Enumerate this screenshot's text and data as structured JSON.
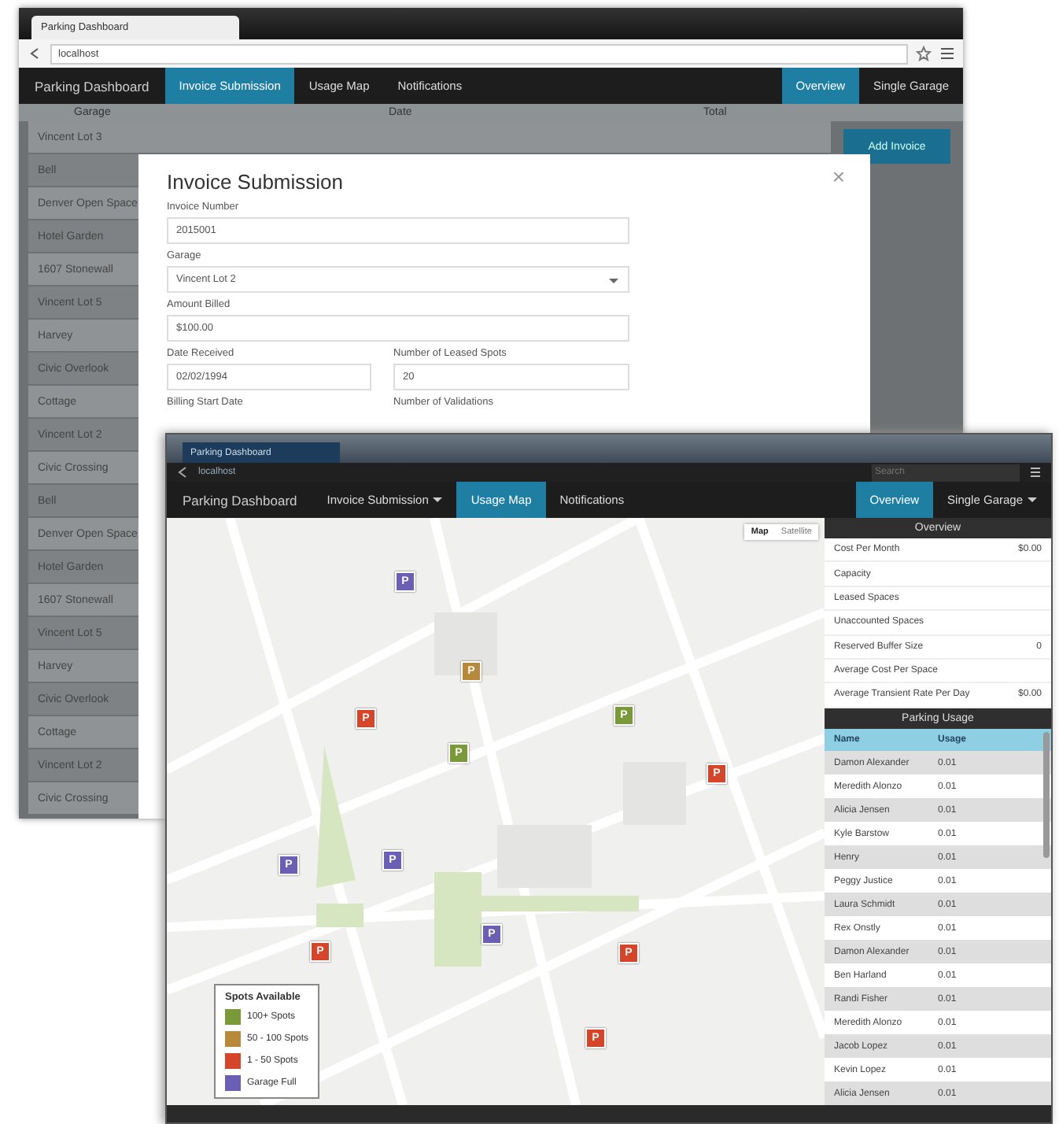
{
  "back_window": {
    "browser_tab": "Parking Dashboard",
    "address": "localhost",
    "brand": "Parking Dashboard",
    "nav": [
      {
        "label": "Invoice Submission",
        "selected": true
      },
      {
        "label": "Usage Map",
        "selected": false
      },
      {
        "label": "Notifications",
        "selected": false
      }
    ],
    "nav_right": [
      {
        "label": "Overview",
        "selected": true
      },
      {
        "label": "Single Garage",
        "selected": false
      }
    ],
    "table": {
      "columns": [
        "Garage",
        "Date",
        "Total"
      ],
      "rows": [
        "Vincent Lot 3",
        "Bell",
        "Denver Open Space",
        "Hotel Garden",
        "1607 Stonewall",
        "Vincent Lot 5",
        "Harvey",
        "Civic Overlook",
        "Cottage",
        "Vincent Lot 2",
        "Civic Crossing",
        "Bell",
        "Denver Open Space",
        "Hotel Garden",
        "1607 Stonewall",
        "Vincent Lot 5",
        "Harvey",
        "Civic Overlook",
        "Cottage",
        "Vincent Lot 2",
        "Civic Crossing"
      ]
    },
    "add_button": "Add Invoice",
    "modal": {
      "title": "Invoice Submission",
      "close": "×",
      "fields": [
        {
          "label": "Invoice Number",
          "value": "2015001",
          "kind": "text"
        },
        {
          "label": "Garage",
          "value": "Vincent Lot 2",
          "kind": "select"
        },
        {
          "label": "Amount Billed",
          "value": "$100.00",
          "kind": "text"
        },
        {
          "label": "Date Received",
          "value": "02/02/1994",
          "kind": "text"
        },
        {
          "label": "Number of Leased Spots",
          "value": "20",
          "kind": "text"
        },
        {
          "label": "Billing Start Date"
        },
        {
          "label": "Number of Validations"
        }
      ]
    }
  },
  "front_window": {
    "browser_tab": "Parking Dashboard",
    "address": "localhost",
    "search_placeholder": "Search",
    "brand": "Parking Dashboard",
    "nav": [
      {
        "label": "Invoice Submission",
        "selected": false,
        "dropdown": true
      },
      {
        "label": "Usage Map",
        "selected": true,
        "dropdown": false
      },
      {
        "label": "Notifications",
        "selected": false,
        "dropdown": false
      }
    ],
    "nav_right": [
      {
        "label": "Overview",
        "selected": true,
        "dropdown": false
      },
      {
        "label": "Single Garage",
        "selected": false,
        "dropdown": true
      }
    ],
    "map_type": [
      {
        "label": "Map",
        "selected": true
      },
      {
        "label": "Satellite",
        "selected": false
      }
    ],
    "markers": [
      {
        "glyph": "P",
        "color": "#6a5fb5"
      },
      {
        "glyph": "P",
        "color": "#b8893a"
      },
      {
        "glyph": "P",
        "color": "#d6452a"
      },
      {
        "glyph": "P",
        "color": "#7a9a3a"
      },
      {
        "glyph": "P",
        "color": "#7a9a3a"
      },
      {
        "glyph": "P",
        "color": "#d6452a"
      },
      {
        "glyph": "P",
        "color": "#6a5fb5"
      },
      {
        "glyph": "P",
        "color": "#6a5fb5"
      },
      {
        "glyph": "P",
        "color": "#6a5fb5"
      },
      {
        "glyph": "P",
        "color": "#d6452a"
      },
      {
        "glyph": "P",
        "color": "#d6452a"
      },
      {
        "glyph": "P",
        "color": "#d6452a"
      }
    ],
    "legend": {
      "title": "Spots Available",
      "items": [
        {
          "label": "100+ Spots",
          "color": "#7a9a3a"
        },
        {
          "label": "50 - 100 Spots",
          "color": "#b8893a"
        },
        {
          "label": "1 - 50 Spots",
          "color": "#d6452a"
        },
        {
          "label": "Garage Full",
          "color": "#6a5fb5"
        }
      ]
    },
    "overview": {
      "title": "Overview",
      "rows": [
        {
          "label": "Cost Per Month",
          "value": "$0.00"
        },
        {
          "label": "Capacity"
        },
        {
          "label": "Leased Spaces"
        },
        {
          "label": "Unaccounted Spaces"
        },
        {
          "label": "Reserved Buffer Size",
          "value": "0"
        },
        {
          "label": "Average Cost Per Space"
        },
        {
          "label": "Average Transient Rate Per Day",
          "value": "$0.00"
        }
      ]
    },
    "usage": {
      "title": "Parking Usage",
      "columns": [
        "Name",
        "Usage"
      ],
      "rows": [
        [
          "Damon Alexander",
          "0.01"
        ],
        [
          "Meredith Alonzo",
          "0.01"
        ],
        [
          "Alicia Jensen",
          "0.01"
        ],
        [
          "Kyle Barstow",
          "0.01"
        ],
        [
          "Henry",
          "0.01"
        ],
        [
          "Peggy Justice",
          "0.01"
        ],
        [
          "Laura Schmidt",
          "0.01"
        ],
        [
          "Rex Onstly",
          "0.01"
        ],
        [
          "Damon Alexander",
          "0.01"
        ],
        [
          "Ben Harland",
          "0.01"
        ],
        [
          "Randi Fisher",
          "0.01"
        ],
        [
          "Meredith Alonzo",
          "0.01"
        ],
        [
          "Jacob Lopez",
          "0.01"
        ],
        [
          "Kevin Lopez",
          "0.01"
        ],
        [
          "Alicia Jensen",
          "0.01"
        ]
      ]
    }
  }
}
